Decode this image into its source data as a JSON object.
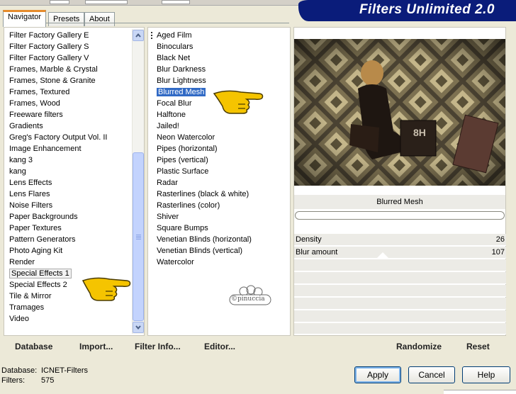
{
  "tabs": [
    {
      "label": "Navigator"
    },
    {
      "label": "Presets"
    },
    {
      "label": "About"
    }
  ],
  "banner": {
    "title": "Filters Unlimited 2.0"
  },
  "categories": [
    "Filter Factory Gallery E",
    "Filter Factory Gallery S",
    "Filter Factory Gallery V",
    "Frames, Marble & Crystal",
    "Frames, Stone & Granite",
    "Frames, Textured",
    "Frames, Wood",
    "Freeware filters",
    "Gradients",
    "Greg's Factory Output Vol. II",
    "Image Enhancement",
    "kang 3",
    "kang",
    "Lens Effects",
    "Lens Flares",
    "Noise Filters",
    "Paper Backgrounds",
    "Paper Textures",
    "Pattern Generators",
    "Photo Aging Kit",
    "Render",
    "Special Effects 1",
    "Special Effects 2",
    "Tile & Mirror",
    "Tramages",
    "Video"
  ],
  "categories_selected_index": 21,
  "filters": [
    "Aged Film",
    "Binoculars",
    "Black Net",
    "Blur Darkness",
    "Blur Lightness",
    "Blurred Mesh",
    "Focal Blur",
    "Halftone",
    "Jailed!",
    "Neon Watercolor",
    "Pipes (horizontal)",
    "Pipes (vertical)",
    "Plastic Surface",
    "Radar",
    "Rasterlines (black & white)",
    "Rasterlines (color)",
    "Shiver",
    "Square Bumps",
    "Venetian Blinds (horizontal)",
    "Venetian Blinds (vertical)",
    "Watercolor"
  ],
  "filters_selected_index": 5,
  "watermark": "©pinuccia",
  "preview": {
    "filter_name": "Blurred Mesh",
    "image_text": "8H"
  },
  "params": [
    {
      "label": "Density",
      "value": "26"
    },
    {
      "label": "Blur amount",
      "value": "107"
    }
  ],
  "toolbar": {
    "database": "Database",
    "import": "Import...",
    "filter_info": "Filter Info...",
    "editor": "Editor...",
    "randomize": "Randomize",
    "reset": "Reset"
  },
  "status": {
    "database_label": "Database:",
    "database_value": "ICNET-Filters",
    "filters_label": "Filters:",
    "filters_value": "575"
  },
  "buttons": {
    "apply": "Apply",
    "cancel": "Cancel",
    "help": "Help"
  },
  "colors": {
    "banner": "#0a1c7a",
    "selection": "#316ac5",
    "pointer": "#f5c400"
  }
}
